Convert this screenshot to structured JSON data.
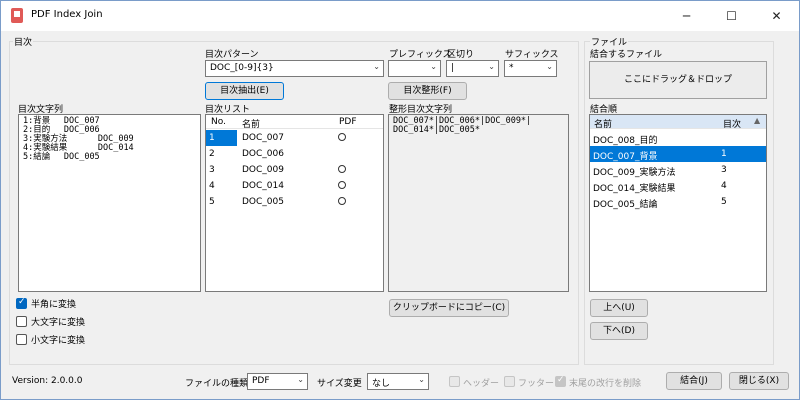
{
  "window": {
    "title": "PDF Index Join",
    "min_glyph": "─",
    "max_glyph": "☐",
    "close_glyph": "✕"
  },
  "toc": {
    "group_label": "目次",
    "pattern_label": "目次パターン",
    "pattern_value": "DOC_[0-9]{3}",
    "prefix_label": "プレフィックス",
    "prefix_value": "",
    "separator_label": "区切り",
    "separator_value": "|",
    "suffix_label": "サフィックス",
    "suffix_value": "*",
    "extract_button": "目次抽出(E)",
    "format_button": "目次整形(F)",
    "text_label": "目次文字列",
    "text_lines": [
      "1:背景　 DOC_007",
      "2:目的　 DOC_006",
      "3:実験方法　　　 DOC_009",
      "4:実験結果　　　 DOC_014",
      "5:結論　 DOC_005"
    ],
    "list_label": "目次リスト",
    "list_headers": {
      "no": "No.",
      "name": "名前",
      "pdf": "PDF"
    },
    "list_rows": [
      {
        "no": "1",
        "name": "DOC_007",
        "pdf": true
      },
      {
        "no": "2",
        "name": "DOC_006",
        "pdf": false
      },
      {
        "no": "3",
        "name": "DOC_009",
        "pdf": true
      },
      {
        "no": "4",
        "name": "DOC_014",
        "pdf": true
      },
      {
        "no": "5",
        "name": "DOC_005",
        "pdf": true
      }
    ],
    "formatted_label": "整形目次文字列",
    "formatted_lines": [
      "DOC_007*|DOC_006*|DOC_009*|",
      "DOC_014*|DOC_005*"
    ],
    "copy_button": "クリップボードにコピー(C)",
    "checkboxes": [
      {
        "label": "半角に変換",
        "checked": true
      },
      {
        "label": "大文字に変換",
        "checked": false
      },
      {
        "label": "小文字に変換",
        "checked": false
      }
    ]
  },
  "file": {
    "group_label": "ファイル",
    "join_files_label": "結合するファイル",
    "drop_zone": "ここにドラッグ＆ドロップ",
    "order_label": "結合順",
    "order_headers": {
      "name": "名前",
      "toc": "目次"
    },
    "order_rows": [
      {
        "name": "DOC_008_目的",
        "toc": ""
      },
      {
        "name": "DOC_007_背景",
        "toc": "1"
      },
      {
        "name": "DOC_009_実験方法",
        "toc": "3"
      },
      {
        "name": "DOC_014_実験結果",
        "toc": "4"
      },
      {
        "name": "DOC_005_結論",
        "toc": "5"
      }
    ],
    "up_button": "上へ(U)",
    "down_button": "下へ(D)"
  },
  "bottom": {
    "version": "Version: 2.0.0.0",
    "file_type_label": "ファイルの種類",
    "file_type_value": "PDF",
    "resize_label": "サイズ変更",
    "resize_value": "なし",
    "header_label": "ヘッダー",
    "footer_label": "フッター",
    "trim_label": "末尾の改行を削除",
    "join_button": "結合(J)",
    "close_button": "閉じる(X)"
  },
  "colors": {
    "selection": "#0078d7",
    "accent_check": "#0067c0"
  }
}
